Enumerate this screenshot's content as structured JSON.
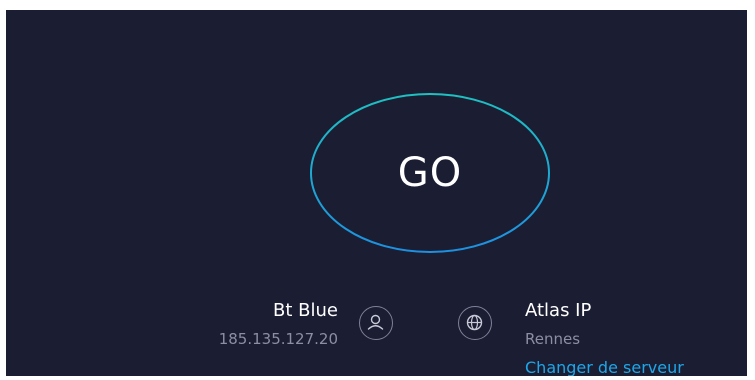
{
  "test": {
    "go_label": "GO"
  },
  "isp": {
    "name": "Bt Blue",
    "ip": "185.135.127.20",
    "icon": "user-icon"
  },
  "server": {
    "name": "Atlas IP",
    "city": "Rennes",
    "change_link": "Changer de serveur",
    "icon": "globe-icon"
  },
  "colors": {
    "background": "#1b1d33",
    "ring_start": "#1fc0c0",
    "ring_end": "#1e90e0",
    "link": "#1ea7e8",
    "muted_text": "#8c8ea3"
  }
}
